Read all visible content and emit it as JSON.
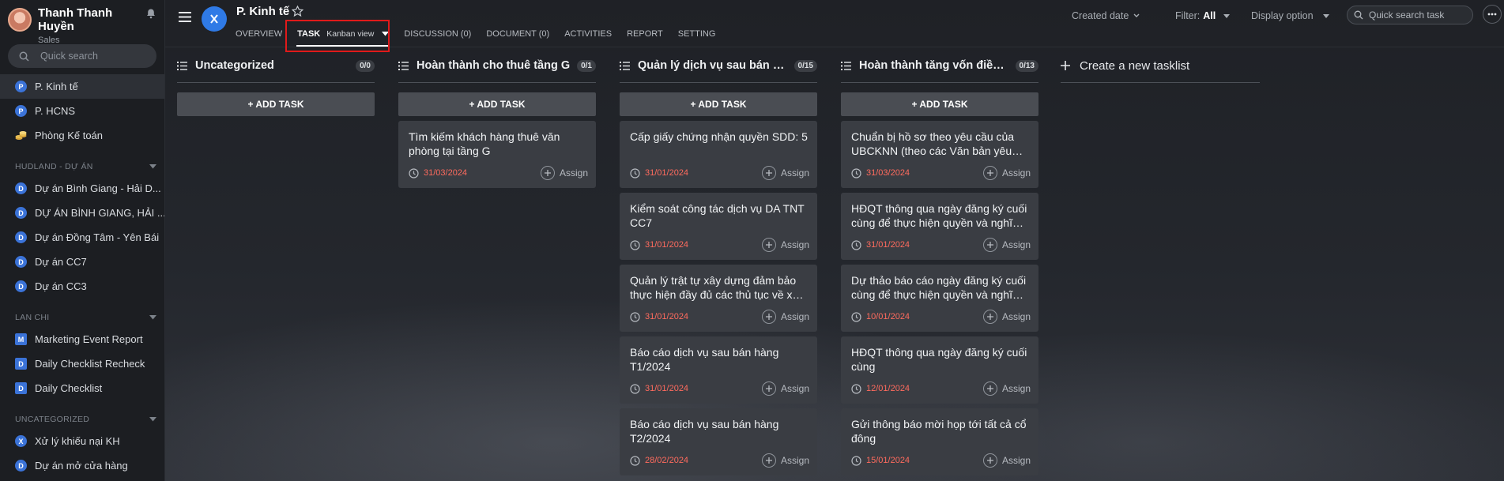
{
  "user": {
    "name": "Thanh Thanh Huyền",
    "role": "Sales"
  },
  "sidebar": {
    "search_placeholder": "Quick search",
    "top_items": [
      {
        "label": "P. Kinh tế",
        "badge": "P"
      },
      {
        "label": "P. HCNS",
        "badge": "P"
      },
      {
        "label": "Phòng Kế toán",
        "badge": "coins"
      }
    ],
    "sections": [
      {
        "title": "HUDLAND - DỰ ÁN",
        "items": [
          {
            "label": "Dự án Bình Giang - Hải D...",
            "badge": "D"
          },
          {
            "label": "DỰ ÁN BÌNH GIANG, HẢI ...",
            "badge": "D"
          },
          {
            "label": "Dự án Đồng Tâm - Yên Bái",
            "badge": "D"
          },
          {
            "label": "Dự án CC7",
            "badge": "D"
          },
          {
            "label": "Dự án CC3",
            "badge": "D"
          }
        ]
      },
      {
        "title": "LAN CHI",
        "items": [
          {
            "label": "Marketing Event Report",
            "badge": "M"
          },
          {
            "label": "Daily Checklist Recheck",
            "badge": "D"
          },
          {
            "label": "Daily Checklist",
            "badge": "D"
          }
        ]
      },
      {
        "title": "UNCATEGORIZED",
        "items": [
          {
            "label": "Xử lý khiếu nại KH",
            "badge": "X"
          },
          {
            "label": "Dự án mở cửa hàng",
            "badge": "D"
          }
        ]
      }
    ]
  },
  "header": {
    "project_name": "P. Kinh tế",
    "tabs": {
      "overview": "OVERVIEW",
      "task": "TASK",
      "task_view": "Kanban view",
      "discussion": "DISCUSSION (0)",
      "document": "DOCUMENT (0)",
      "activities": "ACTIVITIES",
      "report": "REPORT",
      "setting": "SETTING"
    },
    "sort_label": "Created date",
    "filter_label": "Filter:",
    "filter_value": "All",
    "display_option": "Display option",
    "quick_search_placeholder": "Quick search task"
  },
  "board": {
    "add_task_label": "+ ADD TASK",
    "assign_label": "Assign",
    "create_tasklist_label": "Create a new tasklist",
    "columns": [
      {
        "title": "Uncategorized",
        "count": "0/0",
        "cards": []
      },
      {
        "title": "Hoàn thành cho thuê tầng G",
        "count": "0/1",
        "cards": [
          {
            "title": "Tìm kiếm khách hàng thuê văn phòng tại tầng G",
            "date": "31/03/2024"
          }
        ]
      },
      {
        "title": "Quản lý dịch vụ sau bán hàng",
        "count": "0/15",
        "cards": [
          {
            "title": "Cấp giấy chứng nhận quyền SDD: 5",
            "date": "31/01/2024"
          },
          {
            "title": "Kiểm soát công tác dịch vụ DA TNT CC7",
            "date": "31/01/2024"
          },
          {
            "title": "Quản lý trật tự xây dựng đảm bảo thực hiện đầy đủ các thủ tục về xây dựng",
            "date": "31/01/2024"
          },
          {
            "title": "Báo cáo dịch vụ sau bán hàng T1/2024",
            "date": "31/01/2024"
          },
          {
            "title": "Báo cáo dịch vụ sau bán hàng T2/2024",
            "date": "28/02/2024"
          }
        ]
      },
      {
        "title": "Hoàn thành tăng vốn điều lệ",
        "count": "0/13",
        "cards": [
          {
            "title": "Chuẩn bị hồ sơ theo yêu cầu của UBCKNN (theo các Văn bản yêu cầu)",
            "date": "31/03/2024"
          },
          {
            "title": "HĐQT thông qua ngày đăng ký cuối cùng để thực hiện quyền và nghĩa vụ",
            "date": "31/01/2024"
          },
          {
            "title": "Dự thảo báo cáo ngày đăng ký cuối cùng để thực hiện quyền và nghĩa vụ",
            "date": "10/01/2024"
          },
          {
            "title": "HĐQT thông qua ngày đăng ký cuối cùng",
            "date": "12/01/2024"
          },
          {
            "title": "Gửi thông báo mời họp tới tất cả cổ đông",
            "date": "15/01/2024"
          }
        ]
      }
    ]
  },
  "colors": {
    "accent": "#2f7ae6",
    "due_date": "#ff6b5e",
    "highlight": "#e01a1a"
  }
}
